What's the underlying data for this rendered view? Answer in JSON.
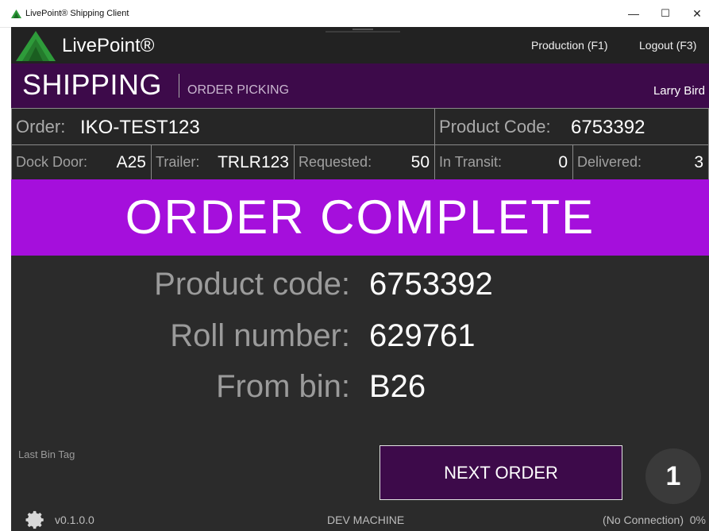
{
  "window": {
    "title": "LivePoint® Shipping Client",
    "minimize_glyph": "—",
    "maximize_glyph": "☐",
    "close_glyph": "✕"
  },
  "header": {
    "brand": "LivePoint®",
    "production_link": "Production (F1)",
    "logout_link": "Logout (F3)",
    "logo_icon": "green-triangle-logo-icon"
  },
  "shipping": {
    "title": "SHIPPING",
    "subtitle": "ORDER PICKING",
    "user": "Larry Bird"
  },
  "order": {
    "order_label": "Order:",
    "order_value": "IKO-TEST123",
    "product_code_label": "Product Code:",
    "product_code_value": "6753392",
    "dock_door_label": "Dock Door:",
    "dock_door_value": "A25",
    "trailer_label": "Trailer:",
    "trailer_value": "TRLR123",
    "requested_label": "Requested:",
    "requested_value": "50",
    "in_transit_label": "In Transit:",
    "in_transit_value": "0",
    "delivered_label": "Delivered:",
    "delivered_value": "3"
  },
  "banner": {
    "text": "ORDER COMPLETE"
  },
  "details": {
    "product_code_label": "Product code:",
    "product_code_value": "6753392",
    "roll_number_label": "Roll number:",
    "roll_number_value": "629761",
    "from_bin_label": "From bin:",
    "from_bin_value": "B26"
  },
  "actions": {
    "last_bin_tag_label": "Last Bin Tag",
    "next_order_label": "NEXT ORDER",
    "count_badge": "1"
  },
  "footer": {
    "version": "v0.1.0.0",
    "machine": "DEV MACHINE",
    "connection": "(No Connection)  0%",
    "settings_icon": "gear-icon"
  },
  "colors": {
    "background": "#2b2b2b",
    "header": "#222222",
    "shipping_band": "#3d0a4a",
    "banner": "#a50fdc",
    "logo_green": "#2e9b3a",
    "next_button": "#3d0a4a"
  }
}
